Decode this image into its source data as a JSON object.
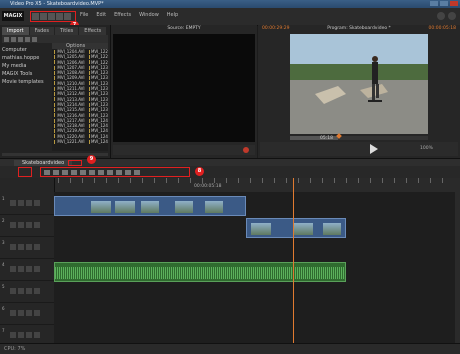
{
  "window": {
    "title": "Video Pro X5 - Skateboardvideo.MVP*"
  },
  "menubar": {
    "logo": "MAGIX",
    "items": [
      "File",
      "Edit",
      "Effects",
      "Window",
      "Help"
    ]
  },
  "badges": {
    "b7": "7",
    "b8": "8",
    "b9": "9",
    "b10": "10"
  },
  "media_pool": {
    "tabs": [
      "Import",
      "Fades",
      "Titles",
      "Effects"
    ],
    "active_tab": "Import",
    "header": "Options",
    "folders": [
      "Computer",
      "mathias.hoppe",
      "My media",
      "MAGIX Tools",
      "Movie templates"
    ],
    "files_col1": [
      "MVI_1204.AVI",
      "MVI_1205.AVI",
      "MVI_1206.AVI",
      "MVI_1207.AVI",
      "MVI_1208.AVI",
      "MVI_1209.AVI",
      "MVI_1210.AVI",
      "MVI_1211.AVI",
      "MVI_1212.AVI",
      "MVI_1213.AVI",
      "MVI_1214.AVI",
      "MVI_1215.AVI",
      "MVI_1216.AVI",
      "MVI_1217.AVI",
      "MVI_1218.AVI",
      "MVI_1219.AVI",
      "MVI_1220.AVI",
      "MVI_1221.AVI"
    ],
    "files_col2": [
      "MVI_122",
      "MVI_122",
      "MVI_122",
      "MVI_123",
      "MVI_123",
      "MVI_123",
      "MVI_123",
      "MVI_123",
      "MVI_123",
      "MVI_123",
      "MVI_123",
      "MVI_123",
      "MVI_123",
      "MVI_124",
      "MVI_124",
      "MVI_124",
      "MVI_124",
      "MVI_124"
    ]
  },
  "source_monitor": {
    "title": "Source: EMPTY",
    "timecode": "00:00:00:00"
  },
  "program_monitor": {
    "title": "Program: Skateboardvideo *",
    "timecode_left": "00:00:29:29",
    "timecode_right": "00:00:05:18",
    "position": "05:18",
    "zoom": "100%"
  },
  "timeline": {
    "tab_name": "Skateboardvideo",
    "ruler_time": "00:00:05:18"
  },
  "tracks": [
    {
      "n": "1",
      "type": "video"
    },
    {
      "n": "2",
      "type": "video"
    },
    {
      "n": "3",
      "type": "empty"
    },
    {
      "n": "4",
      "type": "audio"
    },
    {
      "n": "5",
      "type": "empty"
    },
    {
      "n": "6",
      "type": "empty"
    },
    {
      "n": "7",
      "type": "empty"
    }
  ],
  "status": {
    "text": "CPU: 7%"
  },
  "colors": {
    "accent": "#e07a30",
    "highlight": "#e02020",
    "video_clip": "#3b5a86",
    "audio_clip": "#2f6b2f"
  }
}
